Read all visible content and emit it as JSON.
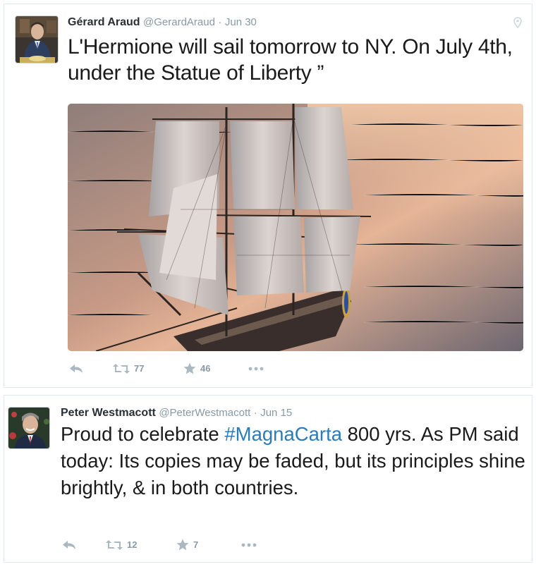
{
  "tweets": [
    {
      "fullname": "Gérard Araud",
      "screenname": "@GerardAraud",
      "dot": "·",
      "time": "Jun 30",
      "text": "L'Hermione will sail tomorrow to NY. On July 4th, under the Statue of Liberty ”",
      "retweets": "77",
      "favorites": "46",
      "has_location": true,
      "media": "tall-ship-sailing-at-sunset"
    },
    {
      "fullname": "Peter Westmacott",
      "screenname": "@PeterWestmacott",
      "dot": "·",
      "time": "Jun 15",
      "text_before": "Proud to celebrate ",
      "hashtag": "#MagnaCarta",
      "text_after": " 800 yrs. As PM said today: Its copies may be faded, but its principles shine brightly, & in both countries.",
      "retweets": "12",
      "favorites": "7"
    }
  ],
  "colors": {
    "link": "#2b7bb9",
    "muted": "#8899a6",
    "action_icon": "#aab8c2",
    "border": "#e1e8ed"
  },
  "icons": [
    "reply-icon",
    "retweet-icon",
    "favorite-star-icon",
    "more-dots-icon",
    "location-pin-icon"
  ]
}
